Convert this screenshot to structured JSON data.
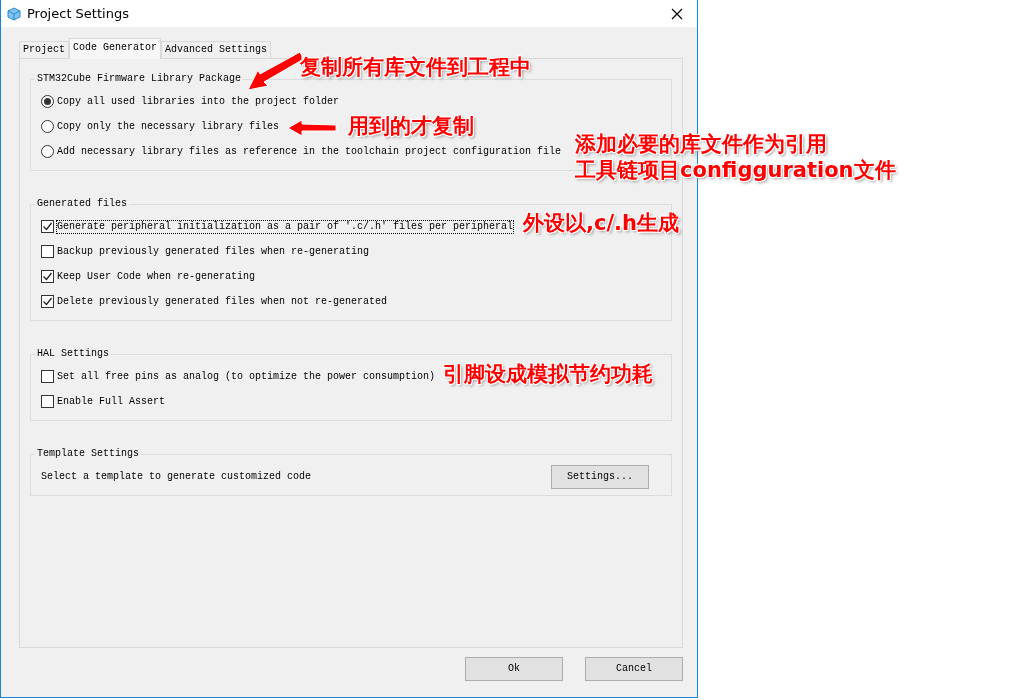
{
  "window": {
    "title": "Project Settings"
  },
  "tabs": [
    {
      "label": "Project",
      "selected": false
    },
    {
      "label": "Code Generator",
      "selected": true
    },
    {
      "label": "Advanced Settings",
      "selected": false
    }
  ],
  "groups": [
    {
      "title": "STM32Cube Firmware Library Package",
      "options": [
        {
          "kind": "radio",
          "label": "Copy all used libraries into the project folder",
          "selected": true,
          "focused": false
        },
        {
          "kind": "radio",
          "label": "Copy only the necessary library files",
          "selected": false,
          "focused": false
        },
        {
          "kind": "radio",
          "label": "Add necessary library files as reference in the toolchain project configuration file",
          "selected": false,
          "focused": false
        }
      ]
    },
    {
      "title": "Generated files",
      "options": [
        {
          "kind": "checkbox",
          "label": "Generate peripheral initialization as a pair of '.c/.h' files per peripheral",
          "checked": true,
          "focused": true
        },
        {
          "kind": "checkbox",
          "label": "Backup previously generated files when re-generating",
          "checked": false,
          "focused": false
        },
        {
          "kind": "checkbox",
          "label": "Keep User Code when re-generating",
          "checked": true,
          "focused": false
        },
        {
          "kind": "checkbox",
          "label": "Delete previously generated files when not re-generated",
          "checked": true,
          "focused": false
        }
      ]
    },
    {
      "title": "HAL Settings",
      "options": [
        {
          "kind": "checkbox",
          "label": "Set all free pins as analog (to optimize the power consumption)",
          "checked": false,
          "focused": false
        },
        {
          "kind": "checkbox",
          "label": "Enable Full Assert",
          "checked": false,
          "focused": false
        }
      ]
    },
    {
      "title": "Template Settings",
      "options": [
        {
          "kind": "text-button",
          "label": "Select a template to generate customized code",
          "button": "Settings..."
        }
      ]
    }
  ],
  "buttons": [
    "Ok",
    "Cancel"
  ],
  "annotations": [
    {
      "lines": [
        "复制所有库文件到工程中"
      ],
      "arrow": true
    },
    {
      "lines": [
        "用到的才复制"
      ],
      "arrow": true
    },
    {
      "lines": [
        "添加必要的库文件作为引用",
        "工具链项目configguration文件"
      ],
      "arrow": false
    },
    {
      "lines": [
        "外设以,c/.h生成"
      ],
      "arrow": false
    },
    {
      "lines": [
        "引脚设成模拟节约功耗"
      ],
      "arrow": false
    }
  ]
}
